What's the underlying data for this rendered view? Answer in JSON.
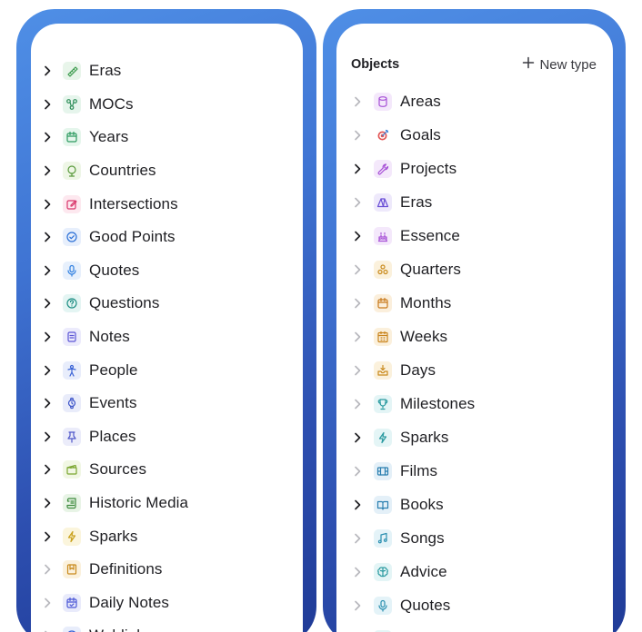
{
  "left_panel": {
    "items": [
      {
        "label": "Eras",
        "icon": "ruler-icon",
        "color": "#3a9a4c",
        "bg": "#e8f5ea",
        "expandable": true
      },
      {
        "label": "MOCs",
        "icon": "graph-icon",
        "color": "#2f8f5a",
        "bg": "#e6f5ec",
        "expandable": true
      },
      {
        "label": "Years",
        "icon": "calendar-icon",
        "color": "#2c9a5f",
        "bg": "#e5f6ec",
        "expandable": true
      },
      {
        "label": "Countries",
        "icon": "globe-icon",
        "color": "#5a9a3c",
        "bg": "#eef6e6",
        "expandable": true
      },
      {
        "label": "Intersections",
        "icon": "edit-icon",
        "color": "#d9366b",
        "bg": "#fde8ef",
        "expandable": true
      },
      {
        "label": "Good Points",
        "icon": "check-circle-icon",
        "color": "#2a6fd6",
        "bg": "#e7effc",
        "expandable": true
      },
      {
        "label": "Quotes",
        "icon": "microphone-icon",
        "color": "#2f7fe0",
        "bg": "#e7f0fc",
        "expandable": true
      },
      {
        "label": "Questions",
        "icon": "question-icon",
        "color": "#1f8f84",
        "bg": "#e4f5f3",
        "expandable": true
      },
      {
        "label": "Notes",
        "icon": "note-icon",
        "color": "#5b55d6",
        "bg": "#ecebfc",
        "expandable": true
      },
      {
        "label": "People",
        "icon": "person-icon",
        "color": "#3a63d6",
        "bg": "#e8edfb",
        "expandable": true
      },
      {
        "label": "Events",
        "icon": "watch-icon",
        "color": "#3f56c9",
        "bg": "#e9ecfa",
        "expandable": true
      },
      {
        "label": "Places",
        "icon": "pin-icon",
        "color": "#4f57c9",
        "bg": "#ebecfa",
        "expandable": true
      },
      {
        "label": "Sources",
        "icon": "clapper-icon",
        "color": "#7aa52f",
        "bg": "#f1f7e4",
        "expandable": true
      },
      {
        "label": "Historic Media",
        "icon": "scroll-icon",
        "color": "#3d8a3d",
        "bg": "#e8f4e6",
        "expandable": true
      },
      {
        "label": "Sparks",
        "icon": "lightning-icon",
        "color": "#c9a11c",
        "bg": "#fbf5dc",
        "expandable": true
      },
      {
        "label": "Definitions",
        "icon": "bookmark-icon",
        "color": "#c98a1c",
        "bg": "#fbf1dc",
        "expandable": false
      },
      {
        "label": "Daily Notes",
        "icon": "calendar-check-icon",
        "color": "#4b57d6",
        "bg": "#e9ebfb",
        "expandable": false
      },
      {
        "label": "Weblinks",
        "icon": "globe-grid-icon",
        "color": "#3a63d6",
        "bg": "#e8edfb",
        "expandable": false
      }
    ]
  },
  "right_panel": {
    "header": {
      "title": "Objects",
      "new_type_label": "New type"
    },
    "items": [
      {
        "label": "Areas",
        "icon": "cylinder-icon",
        "color": "#a64fd6",
        "bg": "#f4e8fb",
        "expandable": false
      },
      {
        "label": "Goals",
        "icon": "target-icon",
        "color": "#d63a3a",
        "bg": "#ffffff",
        "expandable": false
      },
      {
        "label": "Projects",
        "icon": "wrench-icon",
        "color": "#a64fd6",
        "bg": "#f4e8fb",
        "expandable": true
      },
      {
        "label": "Eras",
        "icon": "tent-icon",
        "color": "#6a4fd6",
        "bg": "#eee9fb",
        "expandable": false
      },
      {
        "label": "Essence",
        "icon": "cake-icon",
        "color": "#a64fd6",
        "bg": "#f4e8fb",
        "expandable": true
      },
      {
        "label": "Quarters",
        "icon": "circles-icon",
        "color": "#c98a1c",
        "bg": "#fbf1dc",
        "expandable": false
      },
      {
        "label": "Months",
        "icon": "calendar-icon",
        "color": "#c97a1c",
        "bg": "#fbefdc",
        "expandable": false
      },
      {
        "label": "Weeks",
        "icon": "calendar-grid-icon",
        "color": "#c9841c",
        "bg": "#fbf0dc",
        "expandable": false
      },
      {
        "label": "Days",
        "icon": "inbox-icon",
        "color": "#c98a1c",
        "bg": "#fbf1dc",
        "expandable": false
      },
      {
        "label": "Milestones",
        "icon": "trophy-icon",
        "color": "#2a9aa0",
        "bg": "#e4f5f6",
        "expandable": false
      },
      {
        "label": "Sparks",
        "icon": "lightning-icon",
        "color": "#2a9aa0",
        "bg": "#e4f5f6",
        "expandable": true
      },
      {
        "label": "Films",
        "icon": "film-icon",
        "color": "#2a7fb0",
        "bg": "#e4f0f8",
        "expandable": false
      },
      {
        "label": "Books",
        "icon": "book-icon",
        "color": "#2a7fb0",
        "bg": "#e4f0f8",
        "expandable": true
      },
      {
        "label": "Songs",
        "icon": "music-icon",
        "color": "#2a8fb0",
        "bg": "#e4f3f8",
        "expandable": false
      },
      {
        "label": "Advice",
        "icon": "brain-icon",
        "color": "#2a9aa0",
        "bg": "#e4f5f6",
        "expandable": false
      },
      {
        "label": "Quotes",
        "icon": "microphone-icon",
        "color": "#2a8fb0",
        "bg": "#e4f3f8",
        "expandable": false
      },
      {
        "label": "Locations",
        "icon": "location-icon",
        "color": "#2a9aa0",
        "bg": "#e4f5f6",
        "expandable": false
      }
    ]
  }
}
